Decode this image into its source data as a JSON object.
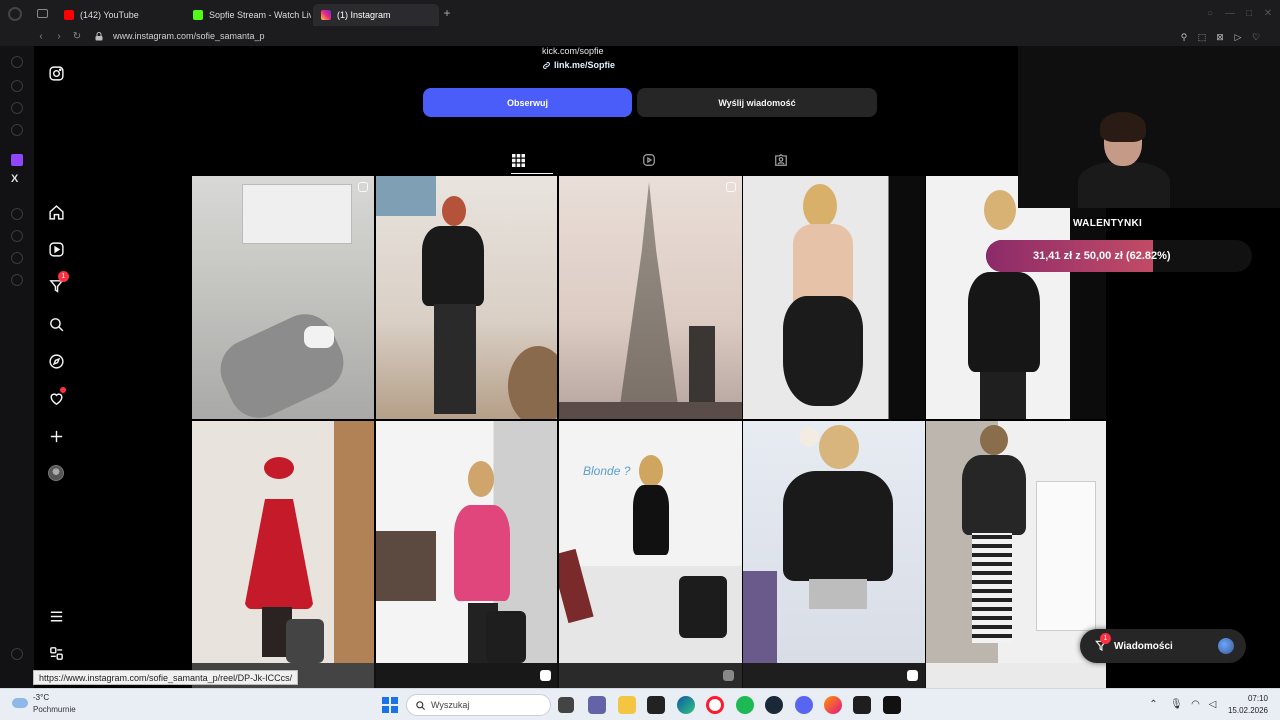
{
  "browser": {
    "tabs": [
      {
        "label": "(142) YouTube",
        "favicon_color": "#ff0000",
        "active": false
      },
      {
        "label": "Sopfie Stream - Watch Liv",
        "favicon_color": "#53fc18",
        "active": false
      },
      {
        "label": "(1) Instagram",
        "favicon_color": "#e1306c",
        "active": true
      }
    ],
    "url": "www.instagram.com/sofie_samanta_p",
    "status_url": "https://www.instagram.com/sofie_samanta_p/reel/DP-Jk-ICCcs/"
  },
  "profile": {
    "bio_line": "kick.com/sopfie",
    "link": "link.me/Sopfie",
    "follow_label": "Obserwuj",
    "message_label": "Wyślij wiadomość"
  },
  "ig_nav": {
    "notifications_badge": "1",
    "items": [
      "instagram-logo-icon",
      "home-icon",
      "reels-icon",
      "direct-icon",
      "search-icon",
      "explore-icon",
      "heart-icon",
      "create-icon",
      "avatar",
      "menu-icon",
      "more-apps-icon"
    ]
  },
  "stream_overlay": {
    "goal_title": "WALENTYNKI",
    "goal_text": "31,41 zł z 50,00 zł (62.82%)",
    "goal_fraction": 0.6282,
    "goal_color_start": "#8c2b6a",
    "goal_color_end": "#c24b66"
  },
  "post_overlay_text": "Blonde ?",
  "messages_pill": {
    "label": "Wiadomości",
    "badge": "1"
  },
  "taskbar": {
    "weather_temp": "-3°C",
    "weather_desc": "Pochmurnie",
    "search_placeholder": "Wyszukaj",
    "time": "07:10",
    "date": "15.02.2026"
  },
  "colors": {
    "follow_button": "#4a5df9",
    "message_button": "#262626",
    "notification_red": "#ff3040"
  }
}
